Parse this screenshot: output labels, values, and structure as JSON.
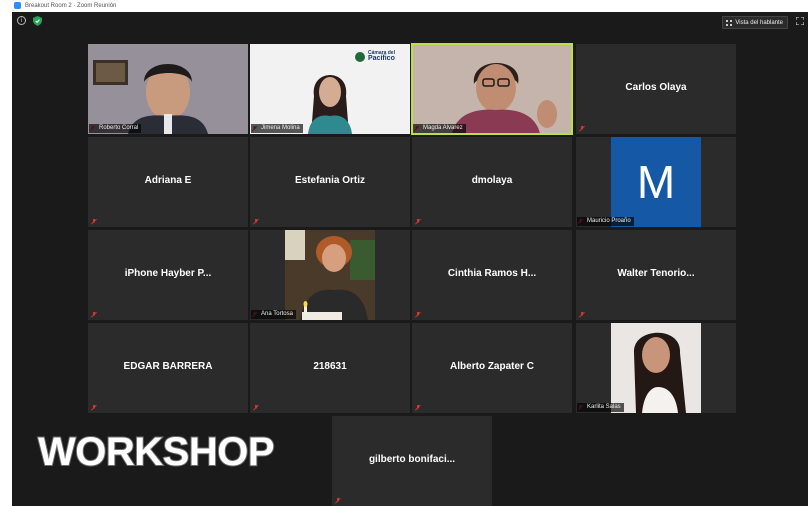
{
  "window": {
    "title": "Breakout Room 2 · Zoom Reunión"
  },
  "toolbar": {
    "view_label": "Vista del hablante"
  },
  "overlay_text": "WORKSHOP",
  "logo": {
    "line1": "Cámara del",
    "line2": "Pacífico"
  },
  "colors": {
    "active_border": "#b9e04a",
    "avatar_bg": "#1559a6",
    "tile_bg": "#2b2b2b",
    "window_bg": "#1a1a1a",
    "mute_icon": "#e53935"
  },
  "participants": [
    {
      "name": "Roberto Corral",
      "type": "video"
    },
    {
      "name": "Jimena Molina",
      "type": "video"
    },
    {
      "name": "Magda Alvarez",
      "type": "video",
      "active": true
    },
    {
      "name": "Carlos Olaya",
      "type": "name"
    },
    {
      "name": "Adriana E",
      "type": "name"
    },
    {
      "name": "Estefania Ortiz",
      "type": "name"
    },
    {
      "name": "dmolaya",
      "type": "name"
    },
    {
      "name": "Mauricio Proaño",
      "type": "avatar",
      "initial": "M"
    },
    {
      "name": "iPhone Hayber P...",
      "type": "name"
    },
    {
      "name": "Ana Tortosa",
      "type": "video"
    },
    {
      "name": "Cinthia Ramos H...",
      "type": "name"
    },
    {
      "name": "Walter Tenorio...",
      "type": "name"
    },
    {
      "name": "EDGAR BARRERA",
      "type": "name"
    },
    {
      "name": "218631",
      "type": "name"
    },
    {
      "name": "Alberto Zapater C",
      "type": "name"
    },
    {
      "name": "Karlita Salas",
      "type": "video"
    },
    {
      "name": "gilberto bonifaci...",
      "type": "name"
    }
  ]
}
